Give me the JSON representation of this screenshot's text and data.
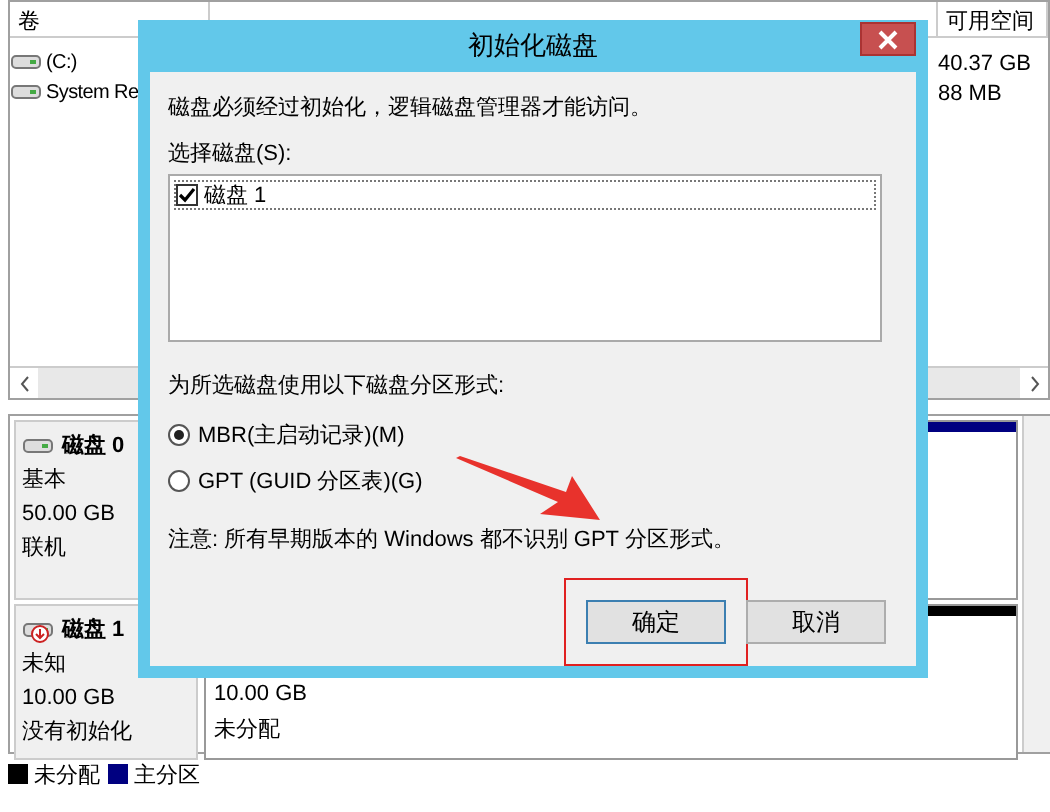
{
  "volume_list": {
    "columns": [
      {
        "label": "卷"
      },
      {
        "label": "可用空间"
      }
    ],
    "rows": [
      {
        "name": "(C:)",
        "free": "40.37 GB"
      },
      {
        "name": "System Re",
        "free": "88 MB"
      }
    ]
  },
  "disks": [
    {
      "name": "磁盘 0",
      "type": "基本",
      "size": "50.00 GB",
      "status": "联机",
      "kind": "online"
    },
    {
      "name": "磁盘 1",
      "type": "未知",
      "size": "10.00 GB",
      "status": "没有初始化",
      "kind": "uninitialized",
      "partition": {
        "size": "10.00 GB",
        "label": "未分配"
      }
    }
  ],
  "legend": [
    {
      "label": "未分配",
      "color": "#000000"
    },
    {
      "label": "主分区",
      "color": "#000080"
    }
  ],
  "dialog": {
    "title": "初始化磁盘",
    "message": "磁盘必须经过初始化，逻辑磁盘管理器才能访问。",
    "select_label": "选择磁盘(S):",
    "disks": [
      {
        "label": "磁盘 1",
        "checked": true
      }
    ],
    "style_label": "为所选磁盘使用以下磁盘分区形式:",
    "styles": [
      {
        "label": "MBR(主启动记录)(M)",
        "selected": true
      },
      {
        "label": "GPT (GUID 分区表)(G)",
        "selected": false
      }
    ],
    "note": "注意: 所有早期版本的 Windows 都不识别 GPT 分区形式。",
    "buttons": [
      {
        "label": "确定",
        "default": true,
        "highlighted": true
      },
      {
        "label": "取消",
        "default": false,
        "highlighted": false
      }
    ]
  }
}
